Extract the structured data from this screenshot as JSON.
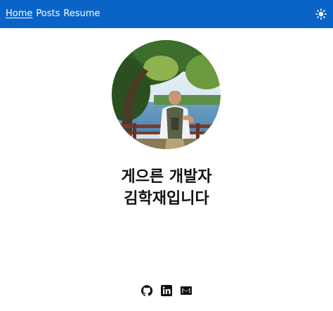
{
  "nav": {
    "items": [
      {
        "label": "Home",
        "active": true
      },
      {
        "label": "Posts",
        "active": false
      },
      {
        "label": "Resume",
        "active": false
      }
    ],
    "theme_toggle_icon": "sun-icon"
  },
  "profile": {
    "avatar_icon": "profile-photo"
  },
  "headline": {
    "line1": "게으른 개발자",
    "line2": "김학재입니다"
  },
  "social": {
    "icons": [
      "github-icon",
      "linkedin-icon",
      "email-icon"
    ]
  },
  "colors": {
    "header_bg": "#0a64c8",
    "text": "#111111",
    "background": "#ffffff"
  }
}
